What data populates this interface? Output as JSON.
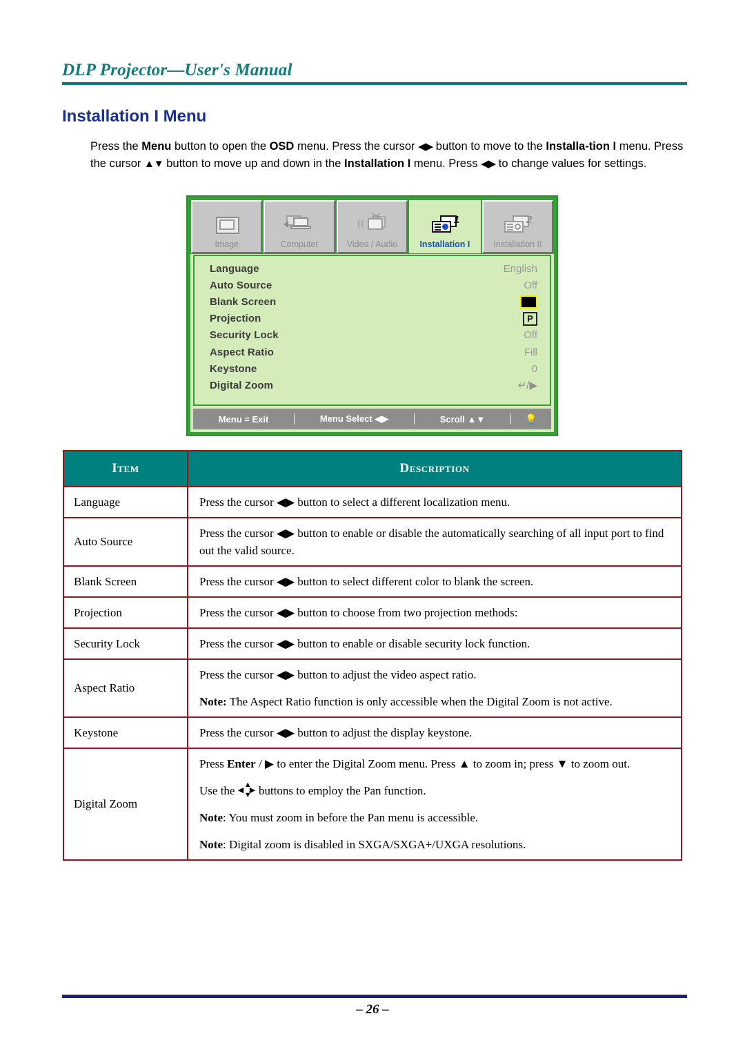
{
  "header": {
    "running_title": "DLP Projector—User's Manual"
  },
  "section": {
    "title": "Installation I Menu",
    "intro_html": "Press the <b>Menu</b> button to open the <b>OSD</b> menu. Press the cursor <span class=\"arrows\">◀▶</span> button to move to the <b>Installa-tion I</b> menu. Press the cursor <span class=\"arrows\">▲▼</span> button to move up and down in the <b>Installation I</b> menu. Press <span class=\"arrows\">◀▶</span> to change values for settings."
  },
  "osd": {
    "tabs": [
      {
        "label": "Image",
        "icon": "image-icon",
        "active": false
      },
      {
        "label": "Computer",
        "icon": "computer-icon",
        "active": false
      },
      {
        "label": "Video / Audio",
        "icon": "video-audio-icon",
        "active": false
      },
      {
        "label": "Installation I",
        "icon": "installation-one-icon",
        "active": true
      },
      {
        "label": "Installation II",
        "icon": "installation-two-icon",
        "active": false
      }
    ],
    "menu_items": [
      {
        "label": "Language",
        "value": "English",
        "value_type": "text"
      },
      {
        "label": "Auto Source",
        "value": "Off",
        "value_type": "text"
      },
      {
        "label": "Blank Screen",
        "value": "",
        "value_type": "color-swatch-black"
      },
      {
        "label": "Projection",
        "value": "P",
        "value_type": "boxed-letter"
      },
      {
        "label": "Security Lock",
        "value": "Off",
        "value_type": "text"
      },
      {
        "label": "Aspect Ratio",
        "value": "Fill",
        "value_type": "text"
      },
      {
        "label": "Keystone",
        "value": "0",
        "value_type": "text"
      },
      {
        "label": "Digital Zoom",
        "value": "↵/▶",
        "value_type": "glyph"
      }
    ],
    "footer": {
      "exit": "Menu = Exit",
      "select": "Menu Select ◀▶",
      "scroll": "Scroll ▲▼",
      "lamp": "💡"
    },
    "colors": {
      "frame_green": "#35a035",
      "panel_green": "#d4ecb9",
      "active_tab_text": "#1054c8",
      "footer_gray": "#8d8d8d",
      "swatch_border_yellow": "#f5e800"
    }
  },
  "table": {
    "headers": [
      "Item",
      "Description"
    ],
    "rows": [
      {
        "item": "Language",
        "paragraphs": [
          "Press the cursor ◀▶ button to select a different localization menu."
        ]
      },
      {
        "item": "Auto Source",
        "paragraphs": [
          "Press the cursor ◀▶ button to enable or disable the automatically searching of all input port to find out the valid source."
        ]
      },
      {
        "item": "Blank Screen",
        "paragraphs": [
          "Press the cursor ◀▶ button to select different color to blank the screen."
        ]
      },
      {
        "item": "Projection",
        "paragraphs": [
          "Press the cursor ◀▶ button to choose from two projection methods:"
        ]
      },
      {
        "item": "Security Lock",
        "paragraphs": [
          "Press the cursor ◀▶ button to enable or disable security lock function."
        ]
      },
      {
        "item": "Aspect Ratio",
        "paragraphs": [
          "Press the cursor ◀▶ button to adjust the video aspect ratio.",
          "<b>Note:</b> The Aspect Ratio function is only accessible when the Digital Zoom is not active."
        ]
      },
      {
        "item": "Keystone",
        "paragraphs": [
          "Press the cursor ◀▶ button to adjust the display keystone."
        ]
      },
      {
        "item": "Digital Zoom",
        "paragraphs": [
          "Press <b>Enter</b> / ▶ to enter the Digital Zoom menu. Press ▲ to zoom in; press ▼ to zoom out.",
          "Use the <span class=\"pan-glyph\"><span class=\"u\">▲</span><span class=\"l\">◀</span><span class=\"r\">▶</span><span class=\"d\">▼</span></span> buttons to employ the Pan function.",
          "<b>Note</b>: You must zoom in before the Pan menu is accessible.",
          "<b>Note</b>: Digital zoom is disabled in SXGA/SXGA+/UXGA resolutions."
        ]
      }
    ]
  },
  "footer": {
    "page_number": "– 26 –"
  }
}
